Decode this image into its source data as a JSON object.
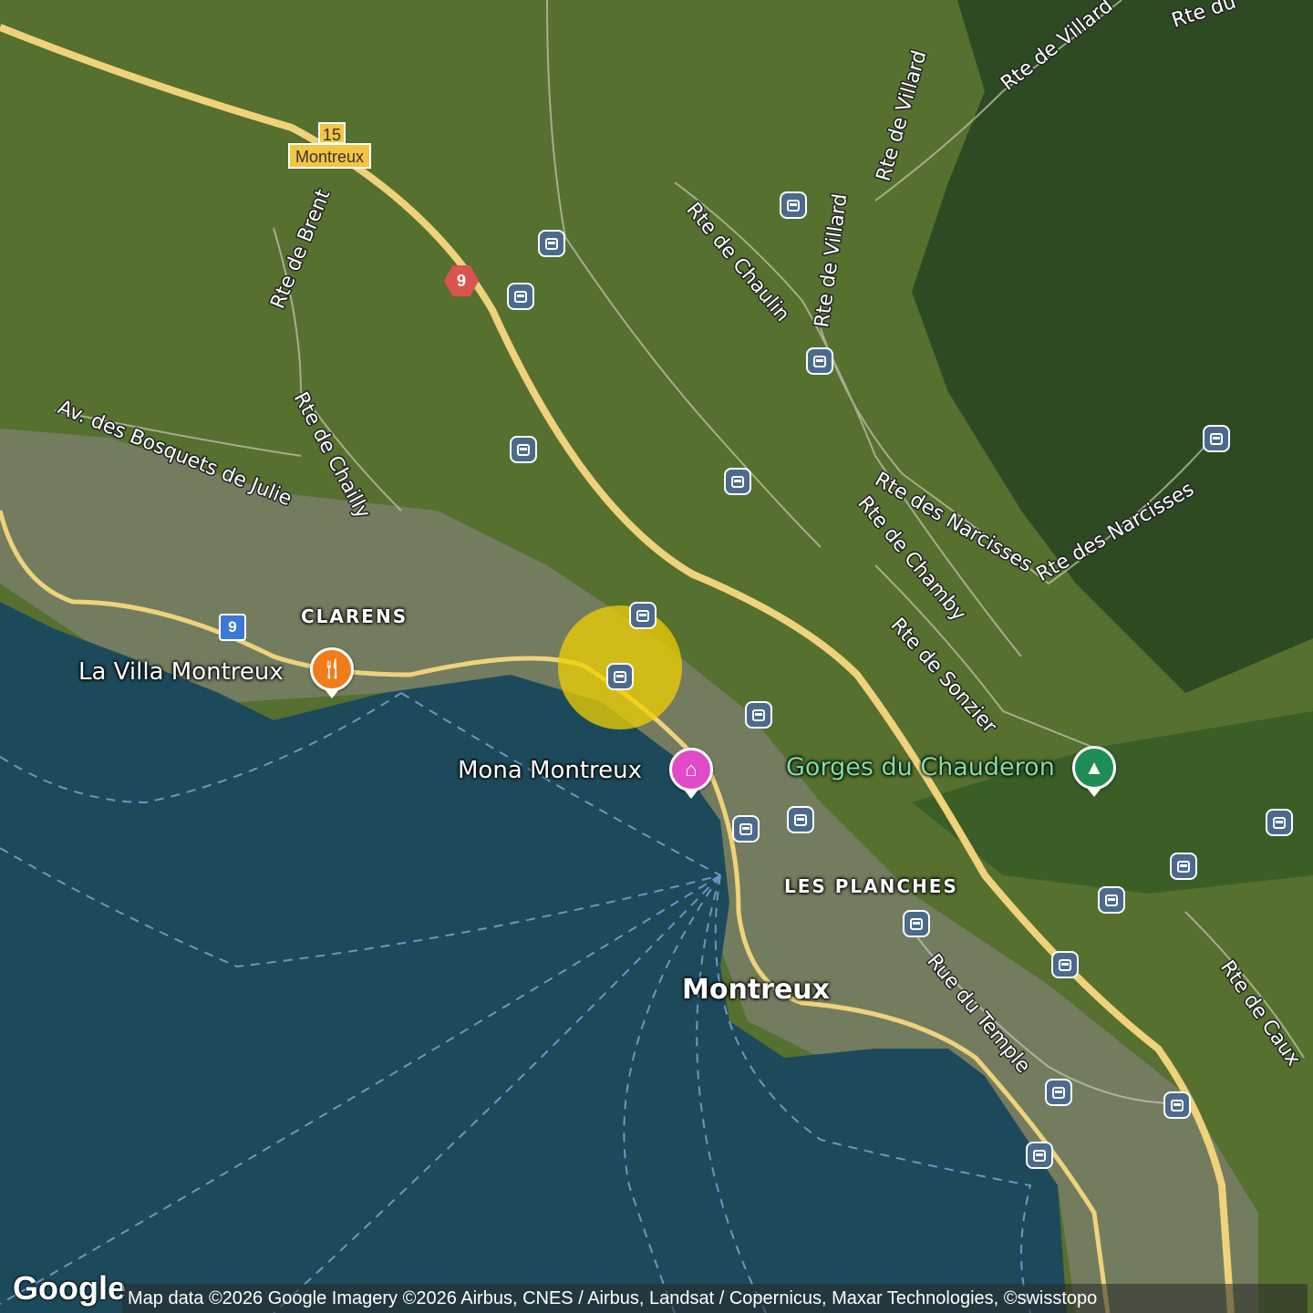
{
  "map": {
    "type": "satellite",
    "colors": {
      "lake": "#1d4a5a",
      "land": "#55702f",
      "forest": "#2d4a22",
      "highway": "#f0d27a",
      "ferry_route": "#7fa0d8",
      "highlight": "#f0d000",
      "transit_icon": "#4b6a8c",
      "restaurant_pin": "#f07d1a",
      "hotel_pin": "#e24bc8",
      "park_pin": "#1e8c57",
      "park_label": "#7ee0a4"
    }
  },
  "road_labels": {
    "brent": "Rte de Brent",
    "chailly": "Rte de Chailly",
    "bosquets": "Av. des Bosquets de Julie",
    "chaulin": "Rte de Chaulin",
    "villard_1": "Rte de Villard",
    "villard_2": "Rte de Villard",
    "villard_3": "Rte de Villard",
    "narcisses_1": "Rte des Narcisses",
    "narcisses_2": "Rte des Narcisses",
    "chamby": "Rte de Chamby",
    "sonzier": "Rte de Sonzier",
    "temple": "Rue du Temple",
    "caux": "Rte de Caux",
    "du": "Rte du"
  },
  "places": {
    "clarens": "CLARENS",
    "les_planches": "LES PLANCHES",
    "montreux": "Montreux"
  },
  "pois": {
    "restaurant": {
      "label": "La Villa Montreux",
      "icon": "restaurant-icon"
    },
    "hotel": {
      "label": "Mona Montreux",
      "icon": "hotel-icon"
    },
    "park": {
      "label": "Gorges du Chauderon",
      "icon": "tree-icon"
    }
  },
  "shields": {
    "exit_number": "15",
    "exit_name": "Montreux",
    "route_red": "9",
    "route_blue": "9"
  },
  "transit_icon": "bus-stop-icon",
  "attribution": "Map data ©2026 Google Imagery ©2026 Airbus, CNES / Airbus, Landsat / Copernicus, Maxar Technologies, ©swisstopo",
  "logo": "Google"
}
